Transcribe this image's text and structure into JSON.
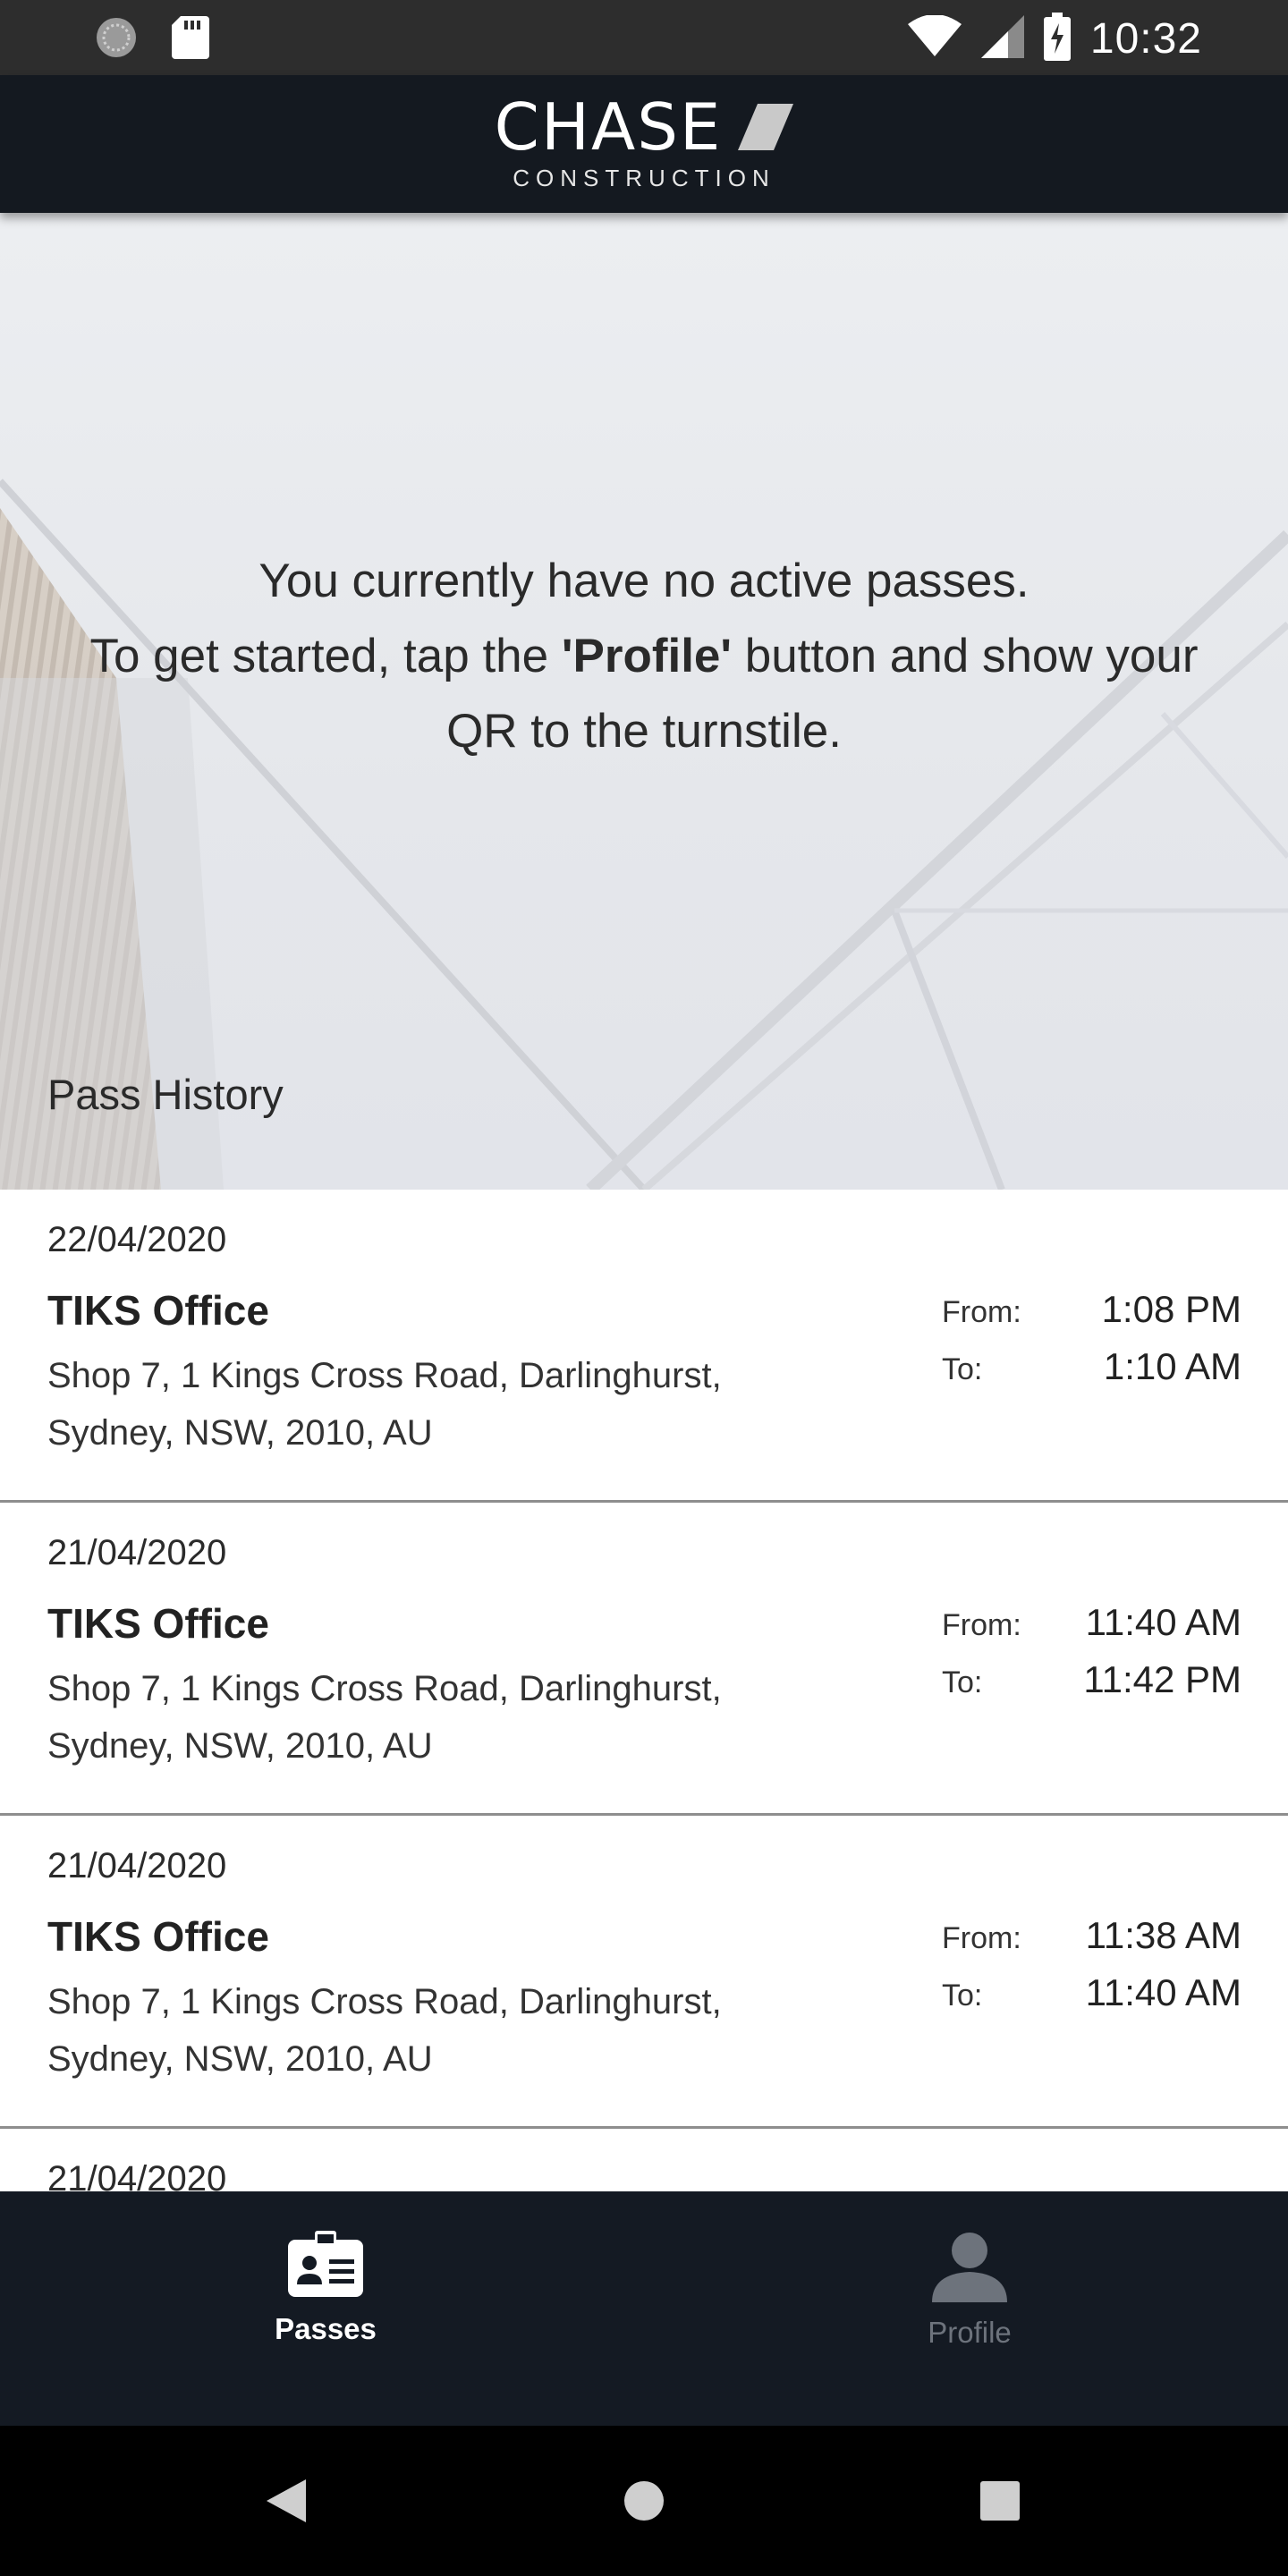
{
  "status_bar": {
    "time": "10:32",
    "left_icons": [
      "sync-icon",
      "sd-card-icon"
    ],
    "right_icons": [
      "wifi-icon",
      "signal-icon",
      "battery-charging-icon"
    ]
  },
  "header": {
    "logo_text": "CHASE",
    "logo_subtext": "CONSTRUCTION"
  },
  "hero": {
    "line1": "You currently have no active passes.",
    "line2_pre": "To get started, tap the ",
    "line2_bold": "'Profile'",
    "line2_post": " button and show your",
    "line3": "QR to the turnstile."
  },
  "pass_history": {
    "title": "Pass History",
    "from_label": "From:",
    "to_label": "To:",
    "items": [
      {
        "date": "22/04/2020",
        "name": "TIKS Office",
        "address": "Shop 7, 1 Kings Cross Road, Darlinghurst, Sydney, NSW, 2010, AU",
        "from": "1:08 PM",
        "to": "1:10 AM"
      },
      {
        "date": "21/04/2020",
        "name": "TIKS Office",
        "address": "Shop 7, 1 Kings Cross Road, Darlinghurst, Sydney, NSW, 2010, AU",
        "from": "11:40 AM",
        "to": "11:42 PM"
      },
      {
        "date": "21/04/2020",
        "name": "TIKS Office",
        "address": "Shop 7, 1 Kings Cross Road, Darlinghurst, Sydney, NSW, 2010, AU",
        "from": "11:38 AM",
        "to": "11:40 AM"
      },
      {
        "date": "21/04/2020",
        "name": "",
        "address": "",
        "from": "",
        "to": ""
      }
    ]
  },
  "bottom_nav": {
    "passes_label": "Passes",
    "profile_label": "Profile",
    "active": "Passes"
  },
  "colors": {
    "header_bg": "#141920",
    "nav_bg": "#141a23",
    "nav_active": "#ffffff",
    "nav_inactive": "#6d737c"
  }
}
